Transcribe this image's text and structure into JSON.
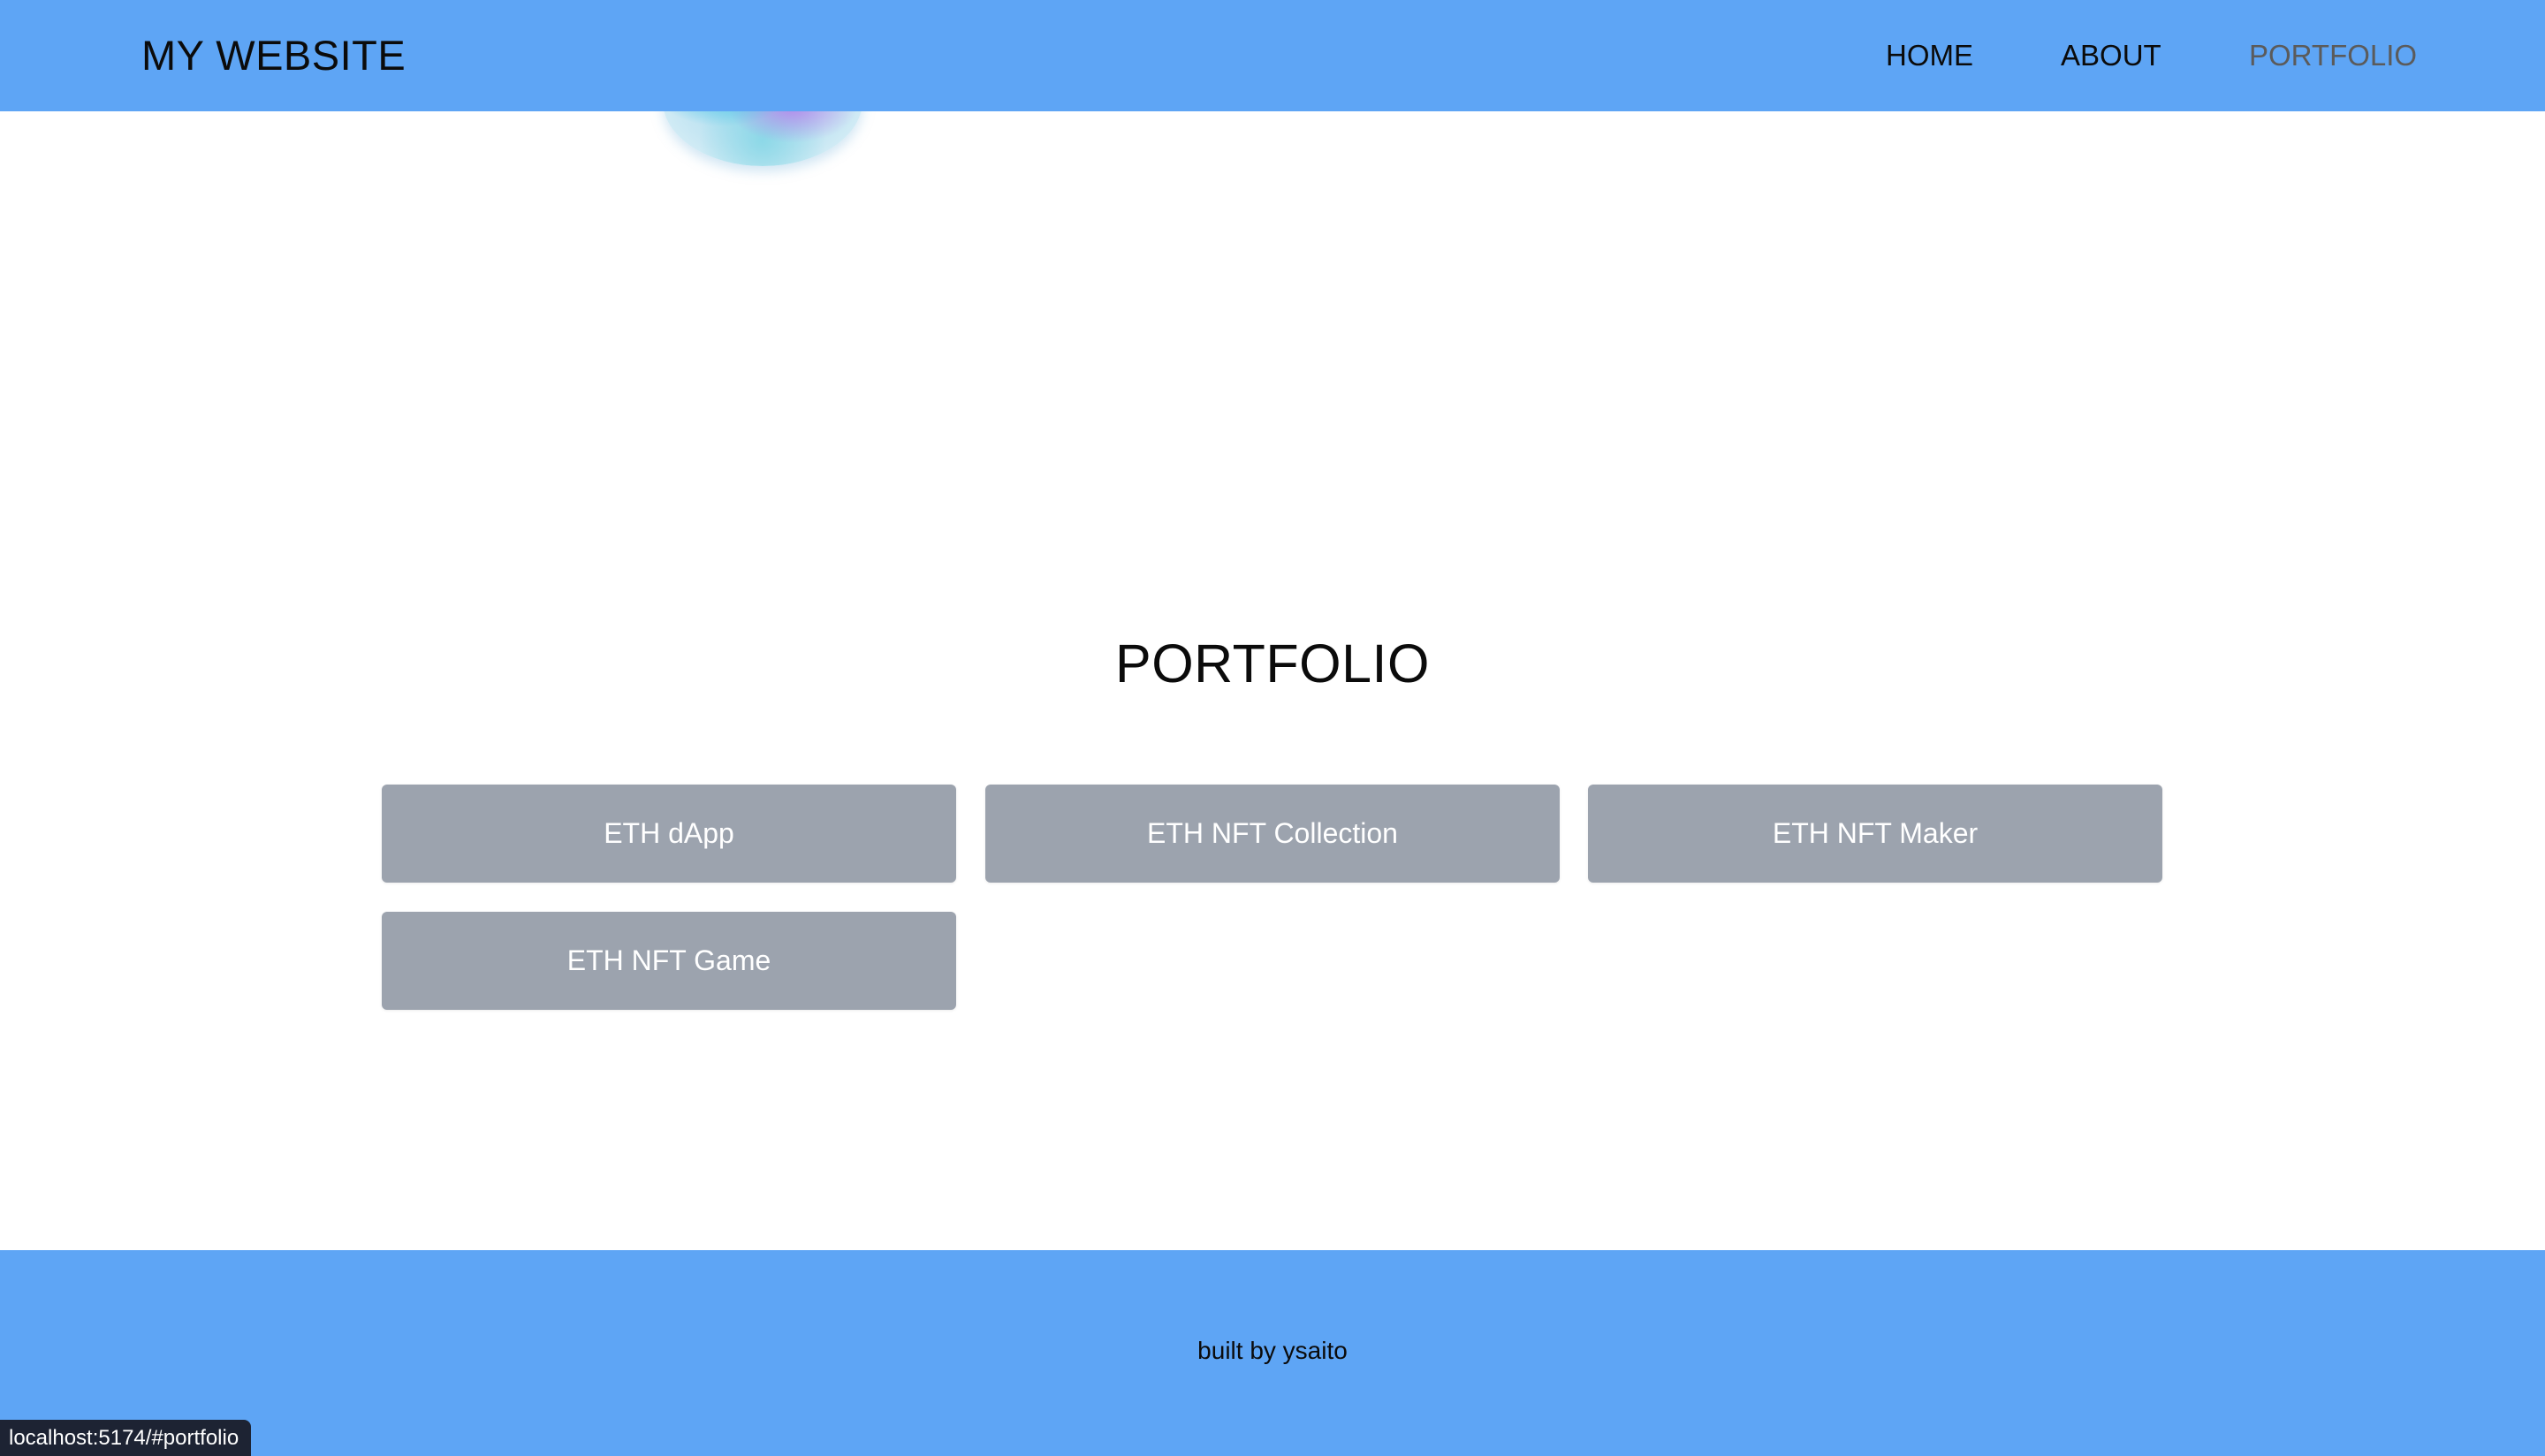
{
  "header": {
    "brand": "MY WEBSITE",
    "nav": [
      {
        "label": "HOME"
      },
      {
        "label": "ABOUT"
      },
      {
        "label": "PORTFOLIO",
        "active": true
      }
    ],
    "background_color": "#5ea5f5"
  },
  "main": {
    "section_title": "PORTFOLIO",
    "projects": [
      {
        "label": "ETH dApp"
      },
      {
        "label": "ETH NFT Collection"
      },
      {
        "label": "ETH NFT Maker"
      },
      {
        "label": "ETH NFT Game"
      }
    ],
    "card_color": "#9ca3ae"
  },
  "footer": {
    "text": "built by ysaito"
  },
  "status_bar": {
    "url": "localhost:5174/#portfolio"
  }
}
